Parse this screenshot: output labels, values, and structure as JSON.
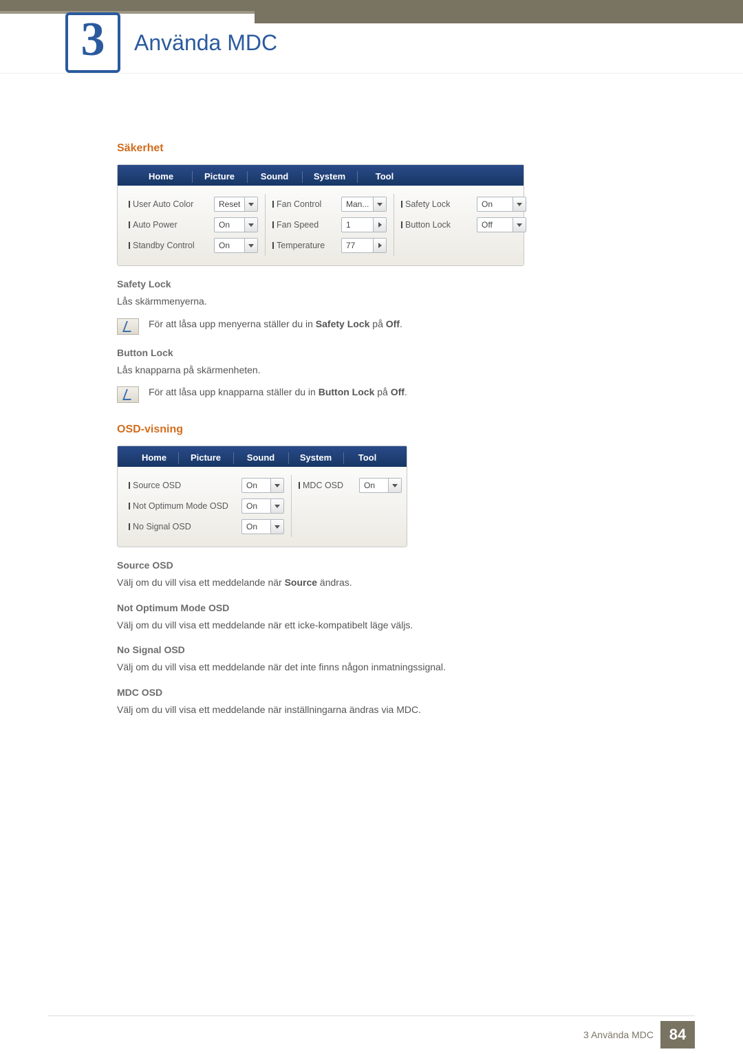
{
  "chapter": {
    "number": "3",
    "title": "Använda MDC"
  },
  "section1": {
    "heading": "Säkerhet",
    "panel": {
      "tabs": [
        "Home",
        "Picture",
        "Sound",
        "System",
        "Tool"
      ],
      "col1": [
        {
          "label": "User Auto Color",
          "value": "Reset",
          "arrow": "down"
        },
        {
          "label": "Auto Power",
          "value": "On",
          "arrow": "down"
        },
        {
          "label": "Standby Control",
          "value": "On",
          "arrow": "down"
        }
      ],
      "col2": [
        {
          "label": "Fan Control",
          "value": "Man...",
          "arrow": "down"
        },
        {
          "label": "Fan Speed",
          "value": "1",
          "arrow": "right"
        },
        {
          "label": "Temperature",
          "value": "77",
          "arrow": "right"
        }
      ],
      "col3": [
        {
          "label": "Safety Lock",
          "value": "On",
          "arrow": "down"
        },
        {
          "label": "Button Lock",
          "value": "Off",
          "arrow": "down"
        }
      ]
    },
    "safety_lock": {
      "title": "Safety Lock",
      "body": "Lås skärmmenyerna.",
      "note_pre": "För att låsa upp menyerna ställer du in ",
      "note_bold": "Safety Lock",
      "note_mid": " på ",
      "note_bold2": "Off",
      "note_post": "."
    },
    "button_lock": {
      "title": "Button Lock",
      "body": "Lås knapparna på skärmenheten.",
      "note_pre": "För att låsa upp knapparna ställer du in ",
      "note_bold": "Button Lock",
      "note_mid": " på ",
      "note_bold2": "Off",
      "note_post": "."
    }
  },
  "section2": {
    "heading": "OSD-visning",
    "panel": {
      "tabs": [
        "Home",
        "Picture",
        "Sound",
        "System",
        "Tool"
      ],
      "col1": [
        {
          "label": "Source OSD",
          "value": "On",
          "arrow": "down"
        },
        {
          "label": "Not Optimum Mode OSD",
          "value": "On",
          "arrow": "down"
        },
        {
          "label": "No Signal OSD",
          "value": "On",
          "arrow": "down"
        }
      ],
      "col2": [
        {
          "label": "MDC OSD",
          "value": "On",
          "arrow": "down"
        }
      ]
    },
    "items": [
      {
        "title": "Source OSD",
        "pre": "Välj om du vill visa ett meddelande när ",
        "bold": "Source",
        "post": " ändras."
      },
      {
        "title": "Not Optimum Mode OSD",
        "pre": "Välj om du vill visa ett meddelande när ett icke-kompatibelt läge väljs.",
        "bold": "",
        "post": ""
      },
      {
        "title": "No Signal OSD",
        "pre": "Välj om du vill visa ett meddelande när det inte finns någon inmatningssignal.",
        "bold": "",
        "post": ""
      },
      {
        "title": "MDC OSD",
        "pre": "Välj om du vill visa ett meddelande när inställningarna ändras via MDC.",
        "bold": "",
        "post": ""
      }
    ]
  },
  "footer": {
    "text": "3 Använda MDC",
    "page": "84"
  }
}
